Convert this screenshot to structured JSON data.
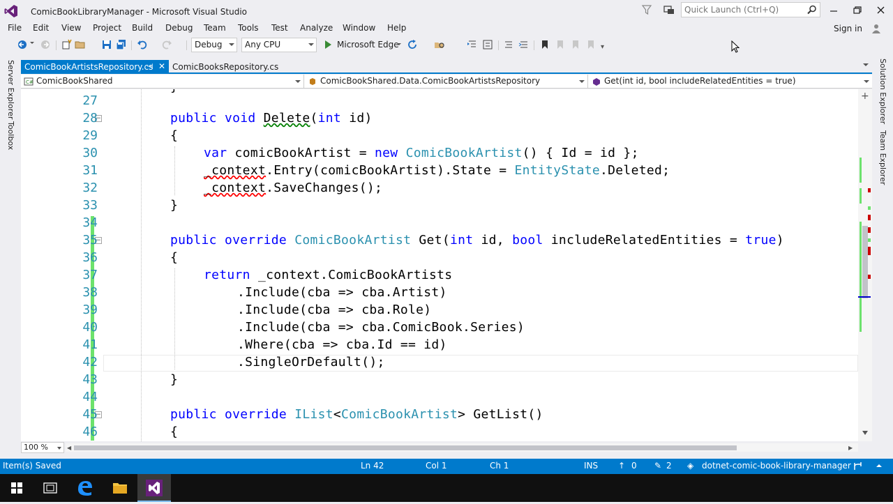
{
  "window": {
    "title": "ComicBookLibraryManager - Microsoft Visual Studio",
    "quick_launch_placeholder": "Quick Launch (Ctrl+Q)"
  },
  "menu": [
    "File",
    "Edit",
    "View",
    "Project",
    "Build",
    "Debug",
    "Team",
    "Tools",
    "Test",
    "Analyze",
    "Window",
    "Help"
  ],
  "sign_in": "Sign in",
  "toolbar": {
    "configuration": "Debug",
    "platform": "Any CPU",
    "run_target": "Microsoft Edge"
  },
  "side_tabs": {
    "left": [
      "Server Explorer",
      "Toolbox"
    ],
    "right": [
      "Solution Explorer",
      "Team Explorer"
    ]
  },
  "tabs": [
    {
      "label": "ComicBookArtistsRepository.cs",
      "active": true
    },
    {
      "label": "ComicBooksRepository.cs",
      "active": false
    }
  ],
  "navbar": {
    "project": "ComicBookShared",
    "type": "ComicBookShared.Data.ComicBookArtistsRepository",
    "member": "Get(int id, bool includeRelatedEntities = true)"
  },
  "code_lines": [
    {
      "n": "27",
      "text": ""
    },
    {
      "n": "28",
      "text": "public void Delete(int id)"
    },
    {
      "n": "29",
      "text": "{"
    },
    {
      "n": "30",
      "text": "var comicBookArtist = new ComicBookArtist() { Id = id };"
    },
    {
      "n": "31",
      "text": "_context.Entry(comicBookArtist).State = EntityState.Deleted;"
    },
    {
      "n": "32",
      "text": "_context.SaveChanges();"
    },
    {
      "n": "33",
      "text": "}"
    },
    {
      "n": "34",
      "text": ""
    },
    {
      "n": "35",
      "text": "public override ComicBookArtist Get(int id, bool includeRelatedEntities = true)"
    },
    {
      "n": "36",
      "text": "{"
    },
    {
      "n": "37",
      "text": "return _context.ComicBookArtists"
    },
    {
      "n": "38",
      "text": ".Include(cba => cba.Artist)"
    },
    {
      "n": "39",
      "text": ".Include(cba => cba.Role)"
    },
    {
      "n": "40",
      "text": ".Include(cba => cba.ComicBook.Series)"
    },
    {
      "n": "41",
      "text": ".Where(cba => cba.Id == id)"
    },
    {
      "n": "42",
      "text": ".SingleOrDefault();"
    },
    {
      "n": "43",
      "text": "}"
    },
    {
      "n": "44",
      "text": ""
    },
    {
      "n": "45",
      "text": "public override IList<ComicBookArtist> GetList()"
    },
    {
      "n": "46",
      "text": "{"
    }
  ],
  "zoom": "100 %",
  "status": {
    "message": "Item(s) Saved",
    "line": "Ln 42",
    "col": "Col 1",
    "ch": "Ch 1",
    "mode": "INS",
    "push_count": "0",
    "edit_count": "2",
    "repo": "dotnet-comic-book-library-manager"
  },
  "colors": {
    "accent": "#007acc",
    "keyword": "#0000ff",
    "type": "#2b91af",
    "change_bar": "#6ce26c"
  }
}
